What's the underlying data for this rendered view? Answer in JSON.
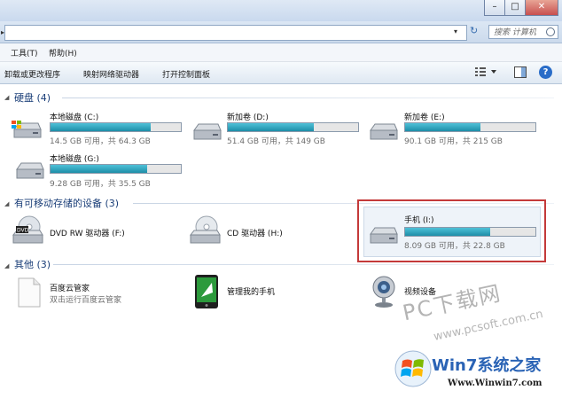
{
  "window": {
    "buttons": {
      "minimize": "–",
      "maximize": "□",
      "close": "✕"
    },
    "search_placeholder": "搜索 计算机"
  },
  "menu": {
    "tools": "工具(T)",
    "help": "帮助(H)"
  },
  "toolbar": {
    "uninstall": "卸载或更改程序",
    "map_drive": "映射网络驱动器",
    "control_panel": "打开控制面板"
  },
  "groups": {
    "hard_disks": "硬盘 (4)",
    "removable": "有可移动存储的设备 (3)",
    "other": "其他 (3)"
  },
  "drives": [
    {
      "name": "本地磁盘 (C:)",
      "info": "14.5 GB 可用，共 64.3 GB",
      "used_fraction": 0.77
    },
    {
      "name": "新加卷 (D:)",
      "info": "51.4 GB 可用，共 149 GB",
      "used_fraction": 0.66
    },
    {
      "name": "新加卷 (E:)",
      "info": "90.1 GB 可用，共 215 GB",
      "used_fraction": 0.58
    },
    {
      "name": "本地磁盘 (G:)",
      "info": "9.28 GB 可用，共 35.5 GB",
      "used_fraction": 0.74
    }
  ],
  "removable": [
    {
      "name": "DVD RW 驱动器 (F:)"
    },
    {
      "name": "CD 驱动器 (H:)"
    },
    {
      "name": "手机 (I:)",
      "info": "8.09 GB 可用，共 22.8 GB",
      "used_fraction": 0.65
    }
  ],
  "other": [
    {
      "name": "百度云管家",
      "sub": "双击运行百度云管家"
    },
    {
      "name": "管理我的手机"
    },
    {
      "name": "视频设备"
    }
  ],
  "watermark": {
    "line1": "PC下载网",
    "line2": "www.pcsoft.com.cn",
    "brand": "Win7系统之家",
    "url": "Www.Winwin7.com"
  }
}
